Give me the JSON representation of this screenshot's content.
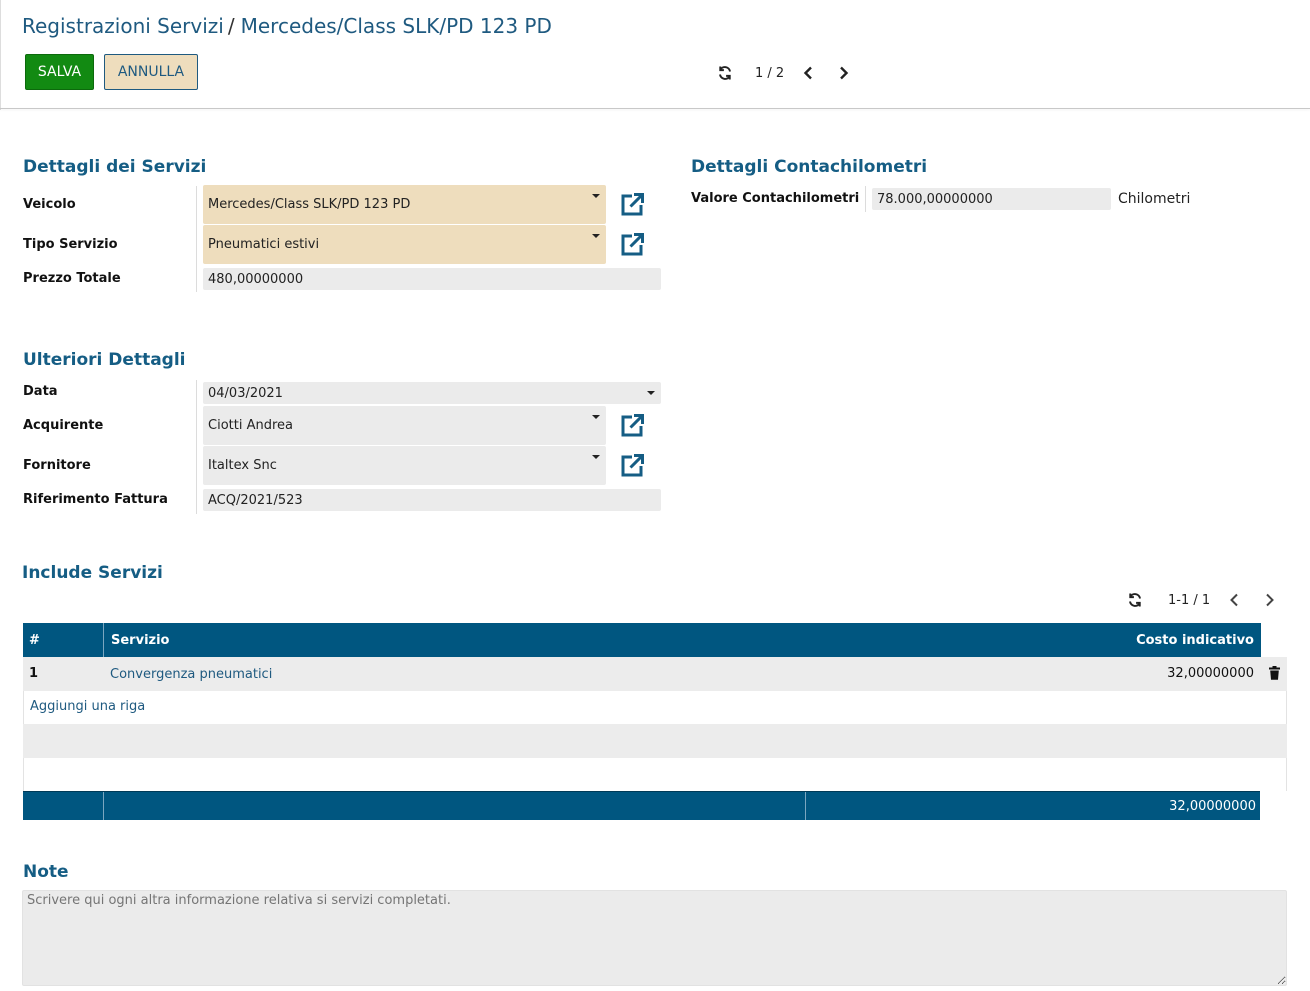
{
  "breadcrumb": {
    "parent": "Registrazioni Servizi",
    "separator": "/",
    "current": "Mercedes/Class SLK/PD 123 PD"
  },
  "toolbar": {
    "save_label": "SALVA",
    "cancel_label": "ANNULLA"
  },
  "pager": {
    "text": "1 / 2",
    "icons": [
      "refresh-icon",
      "chevron-left-icon",
      "chevron-right-icon"
    ]
  },
  "services_details": {
    "title": "Dettagli dei Servizi",
    "vehicle": {
      "label": "Veicolo",
      "value": "Mercedes/Class SLK/PD 123 PD"
    },
    "service_type": {
      "label": "Tipo Servizio",
      "value": "Pneumatici estivi"
    },
    "total_price": {
      "label": "Prezzo Totale",
      "value": "480,00000000"
    }
  },
  "odometer_details": {
    "title": "Dettagli Contachilometri",
    "odometer": {
      "label": "Valore Contachilometri",
      "value": "78.000,00000000",
      "unit": "Chilometri"
    }
  },
  "further_details": {
    "title": "Ulteriori Dettagli",
    "date": {
      "label": "Data",
      "value": "04/03/2021"
    },
    "purchaser": {
      "label": "Acquirente",
      "value": "Ciotti Andrea"
    },
    "vendor": {
      "label": "Fornitore",
      "value": "Italtex Snc"
    },
    "invoice_ref": {
      "label": "Riferimento Fattura",
      "value": "ACQ/2021/523"
    }
  },
  "included_services": {
    "title": "Include Servizi",
    "pager_text": "1-1 / 1",
    "columns": {
      "number": "#",
      "service": "Servizio",
      "cost": "Costo indicativo"
    },
    "rows": [
      {
        "number": "1",
        "service": "Convergenza pneumatici",
        "cost": "32,00000000"
      }
    ],
    "add_line": "Aggiungi una riga",
    "footer_total": "32,00000000"
  },
  "notes": {
    "title": "Note",
    "placeholder": "Scrivere qui ogni altra informazione relativa si servizi completati."
  },
  "colors": {
    "primary": "#005680",
    "title": "#155d84",
    "save_button": "#128a12",
    "required_field": "#eeddbd",
    "field": "#ebebeb"
  }
}
